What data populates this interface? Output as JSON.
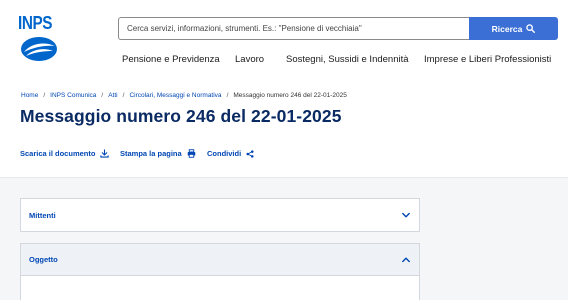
{
  "header": {
    "logo_text": "INPS",
    "search": {
      "placeholder": "Cerca servizi, informazioni, strumenti. Es.: \"Pensione di vecchiaia\"",
      "button_label": "Ricerca",
      "button_icon": "search-icon"
    },
    "nav": [
      {
        "label": "Pensione e Previdenza"
      },
      {
        "label": "Lavoro"
      },
      {
        "label": "Sostegni, Sussidi e Indennità"
      },
      {
        "label": "Imprese e Liberi Professionisti"
      }
    ]
  },
  "breadcrumb": {
    "items": [
      "Home",
      "INPS Comunica",
      "Atti",
      "Circolari, Messaggi e Normativa"
    ],
    "separator": "/",
    "current": "Messaggio numero 246 del 22-01-2025"
  },
  "page_title": "Messaggio numero 246 del 22-01-2025",
  "actions": [
    {
      "label": "Scarica il documento",
      "icon": "download-icon"
    },
    {
      "label": "Stampa la pagina",
      "icon": "printer-icon"
    },
    {
      "label": "Condividi",
      "icon": "share-icon"
    }
  ],
  "accordions": [
    {
      "label": "Mittenti",
      "state": "collapsed",
      "icon": "chevron-down-icon"
    },
    {
      "label": "Oggetto",
      "state": "expanded",
      "icon": "chevron-up-icon"
    }
  ],
  "colors": {
    "brand_blue": "#0066cc",
    "title_navy": "#0a2a63",
    "link_blue": "#0047b3",
    "search_button": "#3c6fd6"
  }
}
